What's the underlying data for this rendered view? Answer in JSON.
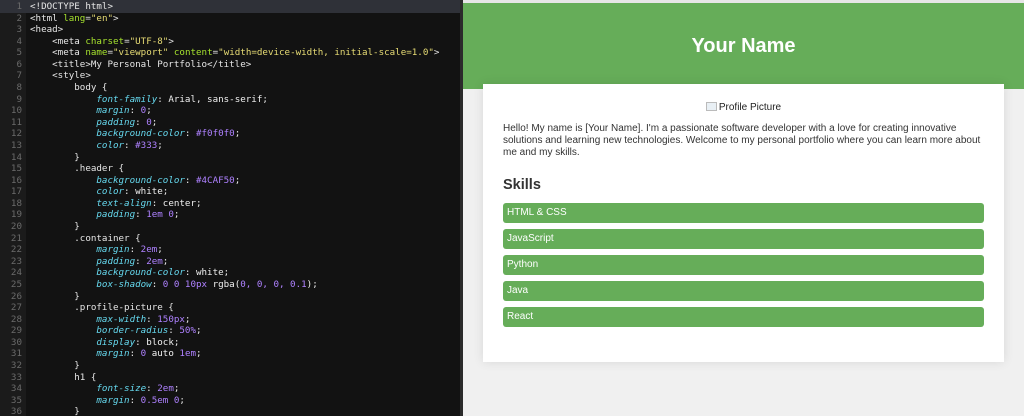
{
  "editor": {
    "lines": [
      [
        [
          "tag",
          "<!DOCTYPE html>"
        ]
      ],
      [
        [
          "tag",
          "<html "
        ],
        [
          "attr",
          "lang"
        ],
        [
          "tag",
          "="
        ],
        [
          "str",
          "\"en\""
        ],
        [
          "tag",
          ">"
        ]
      ],
      [
        [
          "tag",
          "<head>"
        ]
      ],
      [
        [
          "tag",
          "    <meta "
        ],
        [
          "attr",
          "charset"
        ],
        [
          "tag",
          "="
        ],
        [
          "str",
          "\"UTF-8\""
        ],
        [
          "tag",
          ">"
        ]
      ],
      [
        [
          "tag",
          "    <meta "
        ],
        [
          "attr",
          "name"
        ],
        [
          "tag",
          "="
        ],
        [
          "str",
          "\"viewport\""
        ],
        [
          "tag",
          " "
        ],
        [
          "attr",
          "content"
        ],
        [
          "tag",
          "="
        ],
        [
          "str",
          "\"width=device-width, initial-scale=1.0\""
        ],
        [
          "tag",
          ">"
        ]
      ],
      [
        [
          "tag",
          "    <title>My Personal Portfolio</title>"
        ]
      ],
      [
        [
          "tag",
          "    <style>"
        ]
      ],
      [
        [
          "sel",
          "        body {"
        ]
      ],
      [
        [
          "prop",
          "            font-family"
        ],
        [
          "sel",
          ": "
        ],
        [
          "vtext",
          "Arial, sans-serif"
        ],
        [
          "sel",
          ";"
        ]
      ],
      [
        [
          "prop",
          "            margin"
        ],
        [
          "sel",
          ": "
        ],
        [
          "val",
          "0"
        ],
        [
          "sel",
          ";"
        ]
      ],
      [
        [
          "prop",
          "            padding"
        ],
        [
          "sel",
          ": "
        ],
        [
          "val",
          "0"
        ],
        [
          "sel",
          ";"
        ]
      ],
      [
        [
          "prop",
          "            background-color"
        ],
        [
          "sel",
          ": "
        ],
        [
          "val",
          "#f0f0f0"
        ],
        [
          "sel",
          ";"
        ]
      ],
      [
        [
          "prop",
          "            color"
        ],
        [
          "sel",
          ": "
        ],
        [
          "val",
          "#333"
        ],
        [
          "sel",
          ";"
        ]
      ],
      [
        [
          "sel",
          "        }"
        ]
      ],
      [
        [
          "sel",
          "        .header {"
        ]
      ],
      [
        [
          "prop",
          "            background-color"
        ],
        [
          "sel",
          ": "
        ],
        [
          "val",
          "#4CAF50"
        ],
        [
          "sel",
          ";"
        ]
      ],
      [
        [
          "prop",
          "            color"
        ],
        [
          "sel",
          ": "
        ],
        [
          "vtext",
          "white"
        ],
        [
          "sel",
          ";"
        ]
      ],
      [
        [
          "prop",
          "            text-align"
        ],
        [
          "sel",
          ": "
        ],
        [
          "vtext",
          "center"
        ],
        [
          "sel",
          ";"
        ]
      ],
      [
        [
          "prop",
          "            padding"
        ],
        [
          "sel",
          ": "
        ],
        [
          "val",
          "1em 0"
        ],
        [
          "sel",
          ";"
        ]
      ],
      [
        [
          "sel",
          "        }"
        ]
      ],
      [
        [
          "sel",
          "        .container {"
        ]
      ],
      [
        [
          "prop",
          "            margin"
        ],
        [
          "sel",
          ": "
        ],
        [
          "val",
          "2em"
        ],
        [
          "sel",
          ";"
        ]
      ],
      [
        [
          "prop",
          "            padding"
        ],
        [
          "sel",
          ": "
        ],
        [
          "val",
          "2em"
        ],
        [
          "sel",
          ";"
        ]
      ],
      [
        [
          "prop",
          "            background-color"
        ],
        [
          "sel",
          ": "
        ],
        [
          "vtext",
          "white"
        ],
        [
          "sel",
          ";"
        ]
      ],
      [
        [
          "prop",
          "            box-shadow"
        ],
        [
          "sel",
          ": "
        ],
        [
          "val",
          "0 0 10px"
        ],
        [
          "vtext",
          " rgba("
        ],
        [
          "val",
          "0, 0, 0, 0.1"
        ],
        [
          "vtext",
          ")"
        ],
        [
          "sel",
          ";"
        ]
      ],
      [
        [
          "sel",
          "        }"
        ]
      ],
      [
        [
          "sel",
          "        .profile-picture {"
        ]
      ],
      [
        [
          "prop",
          "            max-width"
        ],
        [
          "sel",
          ": "
        ],
        [
          "val",
          "150px"
        ],
        [
          "sel",
          ";"
        ]
      ],
      [
        [
          "prop",
          "            border-radius"
        ],
        [
          "sel",
          ": "
        ],
        [
          "val",
          "50%"
        ],
        [
          "sel",
          ";"
        ]
      ],
      [
        [
          "prop",
          "            display"
        ],
        [
          "sel",
          ": "
        ],
        [
          "vtext",
          "block"
        ],
        [
          "sel",
          ";"
        ]
      ],
      [
        [
          "prop",
          "            margin"
        ],
        [
          "sel",
          ": "
        ],
        [
          "val",
          "0"
        ],
        [
          "vtext",
          " auto "
        ],
        [
          "val",
          "1em"
        ],
        [
          "sel",
          ";"
        ]
      ],
      [
        [
          "sel",
          "        }"
        ]
      ],
      [
        [
          "sel",
          "        h1 {"
        ]
      ],
      [
        [
          "prop",
          "            font-size"
        ],
        [
          "sel",
          ": "
        ],
        [
          "val",
          "2em"
        ],
        [
          "sel",
          ";"
        ]
      ],
      [
        [
          "prop",
          "            margin"
        ],
        [
          "sel",
          ": "
        ],
        [
          "val",
          "0.5em 0"
        ],
        [
          "sel",
          ";"
        ]
      ],
      [
        [
          "sel",
          "        }"
        ]
      ]
    ]
  },
  "preview": {
    "header_title": "Your Name",
    "profile_alt": "Profile Picture",
    "intro": "Hello! My name is [Your Name]. I'm a passionate software developer with a love for creating innovative solutions and learning new technologies. Welcome to my personal portfolio where you can learn more about me and my skills.",
    "skills_heading": "Skills",
    "skills": [
      "HTML & CSS",
      "JavaScript",
      "Python",
      "Java",
      "React"
    ]
  },
  "colors": {
    "accent": "#66ad59",
    "editor_bg": "#121212"
  }
}
